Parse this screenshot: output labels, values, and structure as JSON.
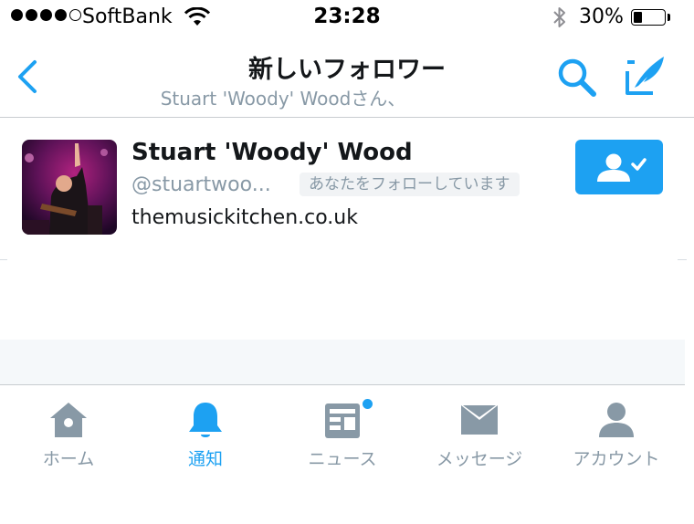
{
  "status_bar": {
    "carrier": "SoftBank",
    "time": "23:28",
    "battery_percent_text": "30%",
    "battery_level": 0.3,
    "signal_bars_filled": 4,
    "signal_bars_total": 5
  },
  "nav": {
    "title": "新しいフォロワー",
    "subtitle": "Stuart 'Woody' Woodさん、",
    "icons": {
      "back": "chevron-left-icon",
      "search": "search-icon",
      "compose": "compose-tweet-icon"
    }
  },
  "follower": {
    "name": "Stuart 'Woody' Wood",
    "handle": "@stuartwoo...",
    "follows_you": "あなたをフォローしています",
    "url": "themusickitchen.co.uk",
    "follow_button_icon": "following-check-icon"
  },
  "tabs": [
    {
      "label": "ホーム",
      "icon": "home-icon",
      "active": false
    },
    {
      "label": "通知",
      "icon": "bell-icon",
      "active": true
    },
    {
      "label": "ニュース",
      "icon": "news-icon",
      "active": false,
      "badge": true
    },
    {
      "label": "メッセージ",
      "icon": "envelope-icon",
      "active": false
    },
    {
      "label": "アカウント",
      "icon": "person-icon",
      "active": false
    }
  ],
  "colors": {
    "accent": "#1da1f2",
    "text_primary": "#14171a",
    "text_secondary": "#8899a6",
    "divider": "#c8ccd0",
    "band": "#f5f8fa"
  }
}
